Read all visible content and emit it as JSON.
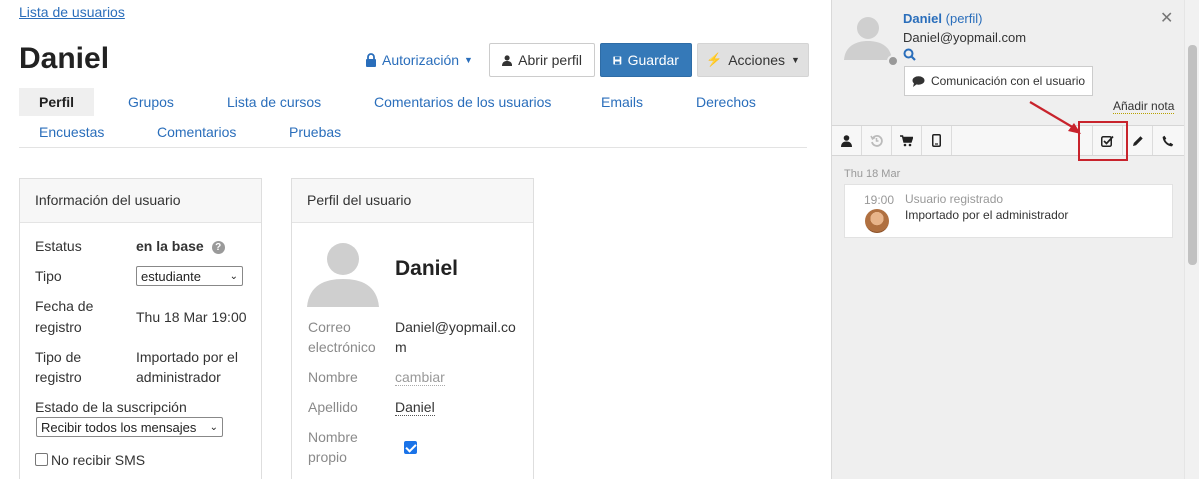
{
  "breadcrumb": "Lista de usuarios",
  "title": "Daniel",
  "toolbar": {
    "auth": "Autorización",
    "open_profile": "Abrir perfil",
    "save": "Guardar",
    "actions": "Acciones"
  },
  "tabs": [
    "Perfil",
    "Grupos",
    "Lista de cursos",
    "Comentarios de los usuarios",
    "Emails",
    "Derechos",
    "Encuestas",
    "Comentarios",
    "Pruebas"
  ],
  "info_panel": {
    "title": "Información del usuario",
    "status_label": "Estatus",
    "status_value": "en la base",
    "type_label": "Tipo",
    "type_value": "estudiante",
    "reg_date_label_1": "Fecha de",
    "reg_date_label_2": "registro",
    "reg_date_value": "Thu 18 Mar 19:00",
    "reg_type_label_1": "Tipo de",
    "reg_type_label_2": "registro",
    "reg_type_value_1": "Importado por el",
    "reg_type_value_2": "administrador",
    "subscription_label": "Estado de la suscripción",
    "subscription_value": "Recibir todos los mensajes",
    "no_sms": "No recibir SMS"
  },
  "profile_panel": {
    "title": "Perfil del usuario",
    "name": "Daniel",
    "email_label_1": "Correo",
    "email_label_2": "electrónico",
    "email_value_1": "Daniel@yopmail.co",
    "email_value_2": "m",
    "nombre_label": "Nombre",
    "nombre_value": "cambiar",
    "apellido_label": "Apellido",
    "apellido_value": "Daniel",
    "nombre_propio_label_1": "Nombre",
    "nombre_propio_label_2": "propio",
    "nombre_propio_checked": true
  },
  "sidebar": {
    "name": "Daniel",
    "profile_link": "(perfil)",
    "email": "Daniel@yopmail.com",
    "comm_button": "Comunicación con el usuario",
    "add_note": "Añadir nota",
    "icons": [
      "user-icon",
      "history-icon",
      "cart-icon",
      "mobile-icon",
      "task-check-icon",
      "pencil-icon",
      "phone-icon"
    ],
    "date": "Thu 18 Mar",
    "event": {
      "time": "19:00",
      "title": "Usuario registrado",
      "desc": "Importado por el administrador"
    }
  },
  "colors": {
    "link": "#2a6ebb",
    "primary": "#3579b8",
    "highlight": "#c8232c"
  }
}
